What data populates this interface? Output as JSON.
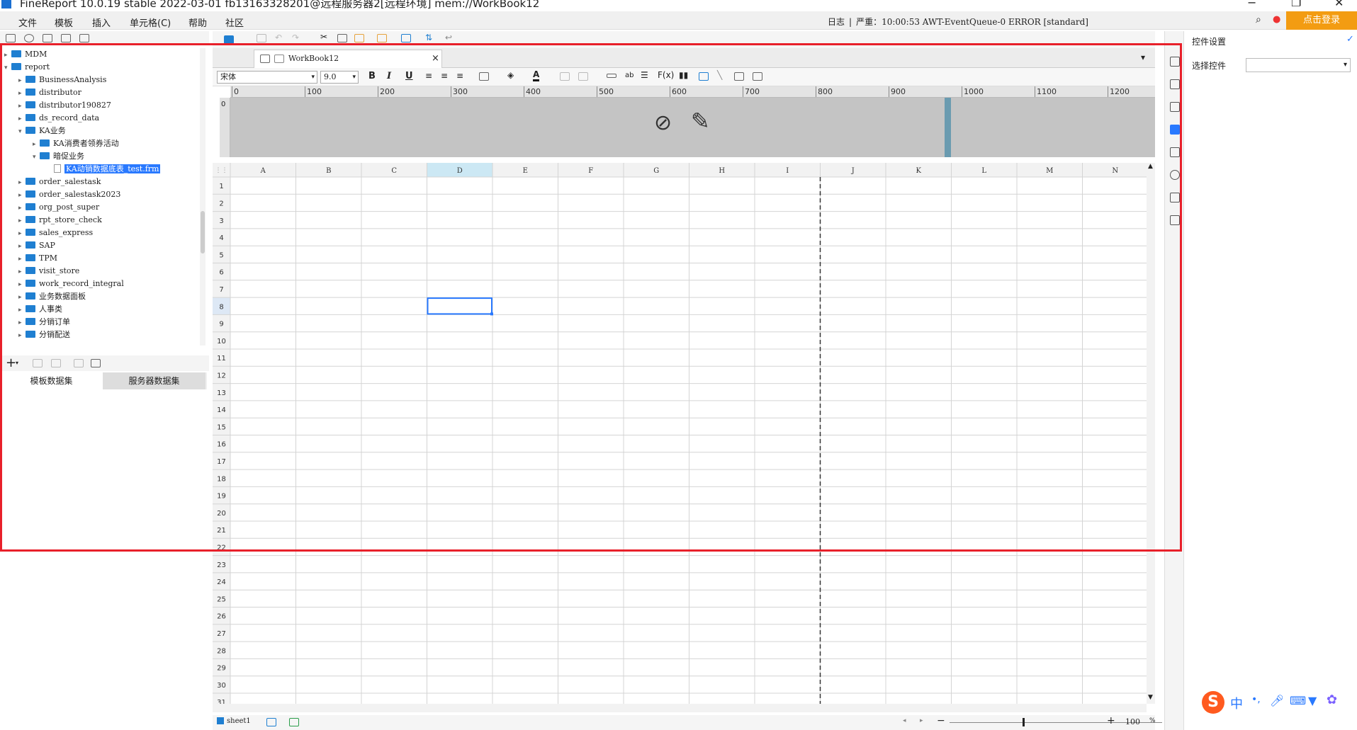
{
  "window": {
    "title": "FineReport 10.0.19 stable 2022-03-01 fb13163328201@远程服务器2[远程环境]    mem://WorkBook12"
  },
  "menu": {
    "items": [
      "文件",
      "模板",
      "插入",
      "单元格(C)",
      "帮助",
      "社区"
    ]
  },
  "log": {
    "label": "日志",
    "severity": "严重：10:00:53 AWT-EventQueue-0 ERROR [standard]"
  },
  "login_button": "点击登录",
  "tree": {
    "nodes": [
      {
        "label": "MDM",
        "depth": 0,
        "expanded": false,
        "type": "folder"
      },
      {
        "label": "report",
        "depth": 0,
        "expanded": true,
        "type": "folder"
      },
      {
        "label": "BusinessAnalysis",
        "depth": 1,
        "expanded": false,
        "type": "folder"
      },
      {
        "label": "distributor",
        "depth": 1,
        "expanded": false,
        "type": "folder"
      },
      {
        "label": "distributor190827",
        "depth": 1,
        "expanded": false,
        "type": "folder"
      },
      {
        "label": "ds_record_data",
        "depth": 1,
        "expanded": false,
        "type": "folder"
      },
      {
        "label": "KA业务",
        "depth": 1,
        "expanded": true,
        "type": "folder"
      },
      {
        "label": "KA消费者领券活动",
        "depth": 2,
        "expanded": false,
        "type": "folder"
      },
      {
        "label": "暗促业务",
        "depth": 2,
        "expanded": true,
        "type": "folder"
      },
      {
        "label": "KA动销数据底表_test.frm",
        "depth": 3,
        "expanded": false,
        "type": "file",
        "selected": true
      },
      {
        "label": "order_salestask",
        "depth": 1,
        "expanded": false,
        "type": "folder"
      },
      {
        "label": "order_salestask2023",
        "depth": 1,
        "expanded": false,
        "type": "folder"
      },
      {
        "label": "org_post_super",
        "depth": 1,
        "expanded": false,
        "type": "folder"
      },
      {
        "label": "rpt_store_check",
        "depth": 1,
        "expanded": false,
        "type": "folder"
      },
      {
        "label": "sales_express",
        "depth": 1,
        "expanded": false,
        "type": "folder"
      },
      {
        "label": "SAP",
        "depth": 1,
        "expanded": false,
        "type": "folder"
      },
      {
        "label": "TPM",
        "depth": 1,
        "expanded": false,
        "type": "folder"
      },
      {
        "label": "visit_store",
        "depth": 1,
        "expanded": false,
        "type": "folder"
      },
      {
        "label": "work_record_integral",
        "depth": 1,
        "expanded": false,
        "type": "folder"
      },
      {
        "label": "业务数据面板",
        "depth": 1,
        "expanded": false,
        "type": "folder"
      },
      {
        "label": "人事类",
        "depth": 1,
        "expanded": false,
        "type": "folder"
      },
      {
        "label": "分销订单",
        "depth": 1,
        "expanded": false,
        "type": "folder"
      },
      {
        "label": "分销配送",
        "depth": 1,
        "expanded": false,
        "type": "folder"
      }
    ]
  },
  "dataset_tabs": {
    "template": "模板数据集",
    "server": "服务器数据集"
  },
  "doc_tab": {
    "name": "WorkBook12",
    "close": "×"
  },
  "format": {
    "font": "宋体",
    "size": "9.0",
    "bold": "B",
    "italic": "I",
    "underline": "U"
  },
  "ruler": {
    "marks": [
      "0",
      "100",
      "200",
      "300",
      "400",
      "500",
      "600",
      "700",
      "800",
      "900",
      "1000",
      "1100",
      "1200"
    ]
  },
  "vruler_label": "0",
  "sheet": {
    "columns": [
      "A",
      "B",
      "C",
      "D",
      "E",
      "F",
      "G",
      "H",
      "I",
      "J",
      "K",
      "L",
      "M",
      "N"
    ],
    "rows": [
      "1",
      "2",
      "3",
      "4",
      "5",
      "6",
      "7",
      "8",
      "9",
      "10",
      "11",
      "12",
      "13",
      "14",
      "15",
      "16",
      "17",
      "18",
      "19",
      "20",
      "21",
      "22",
      "23",
      "24",
      "25",
      "26",
      "27",
      "28",
      "29",
      "30",
      "31"
    ],
    "selected_cell": "D8"
  },
  "status": {
    "sheet_name": "sheet1",
    "zoom": "100",
    "percent": "%"
  },
  "right_panel": {
    "title": "控件设置",
    "select_label": "选择控件",
    "select_value": ""
  },
  "ime": {
    "logo": "S",
    "lang": "中",
    "punct": "•,"
  },
  "colors": {
    "accent": "#2979ff",
    "folder": "#1f7fd1",
    "login": "#f39c12",
    "highlight": "#e8202a",
    "selected_col_header": "#cce8f4"
  }
}
